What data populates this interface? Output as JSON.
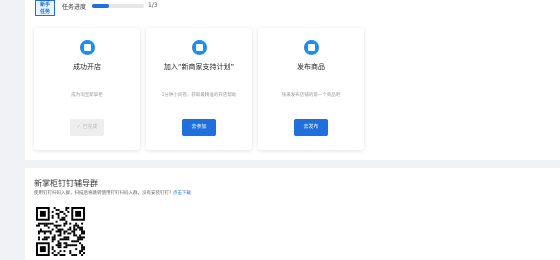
{
  "header": {
    "badge_line1": "新手",
    "badge_line2": "任务",
    "progress_label": "任务进度",
    "progress_count": "1/3",
    "progress_fraction": 0.33
  },
  "cards": [
    {
      "title": "成功开店",
      "desc": "成为淘宝新掌柜",
      "button": "✓ 已完成",
      "icon": "store-icon"
    },
    {
      "title": "加入“新商家支持计划”",
      "desc": "1分钟小问卷，获取最精准的开店帮助",
      "button": "去参加",
      "icon": "clipboard-icon"
    },
    {
      "title": "发布商品",
      "desc": "快来发布店铺的第一个商品吧",
      "button": "去发布",
      "icon": "product-icon"
    }
  ],
  "group": {
    "title": "新掌柜钉钉辅导群",
    "desc": "使用钉钉扫码入群，扫描后将跳转使用钉钉扫码入群，没有安装钉钉?",
    "link": "点击下载"
  },
  "colors": {
    "accent": "#1f6fdc",
    "icon_bg": "#1f8cf0"
  }
}
